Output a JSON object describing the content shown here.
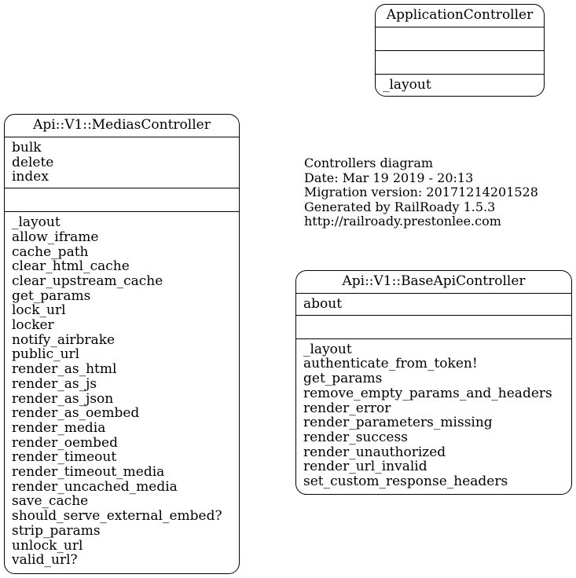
{
  "info": {
    "lines": [
      "Controllers diagram",
      "Date: Mar 19 2019 - 20:13",
      "Migration version: 20171214201528",
      "Generated by RailRoady 1.5.3",
      "http://railroady.prestonlee.com"
    ]
  },
  "nodes": {
    "application": {
      "title": "ApplicationController",
      "public_methods": [],
      "protected_methods": [],
      "private_methods": [
        "_layout"
      ]
    },
    "medias": {
      "title": "Api::V1::MediasController",
      "public_methods": [
        "bulk",
        "delete",
        "index"
      ],
      "protected_methods": [],
      "private_methods": [
        "_layout",
        "allow_iframe",
        "cache_path",
        "clear_html_cache",
        "clear_upstream_cache",
        "get_params",
        "lock_url",
        "locker",
        "notify_airbrake",
        "public_url",
        "render_as_html",
        "render_as_js",
        "render_as_json",
        "render_as_oembed",
        "render_media",
        "render_oembed",
        "render_timeout",
        "render_timeout_media",
        "render_uncached_media",
        "save_cache",
        "should_serve_external_embed?",
        "strip_params",
        "unlock_url",
        "valid_url?"
      ]
    },
    "base_api": {
      "title": "Api::V1::BaseApiController",
      "public_methods": [
        "about"
      ],
      "protected_methods": [],
      "private_methods": [
        "_layout",
        "authenticate_from_token!",
        "get_params",
        "remove_empty_params_and_headers",
        "render_error",
        "render_parameters_missing",
        "render_success",
        "render_unauthorized",
        "render_url_invalid",
        "set_custom_response_headers"
      ]
    }
  }
}
